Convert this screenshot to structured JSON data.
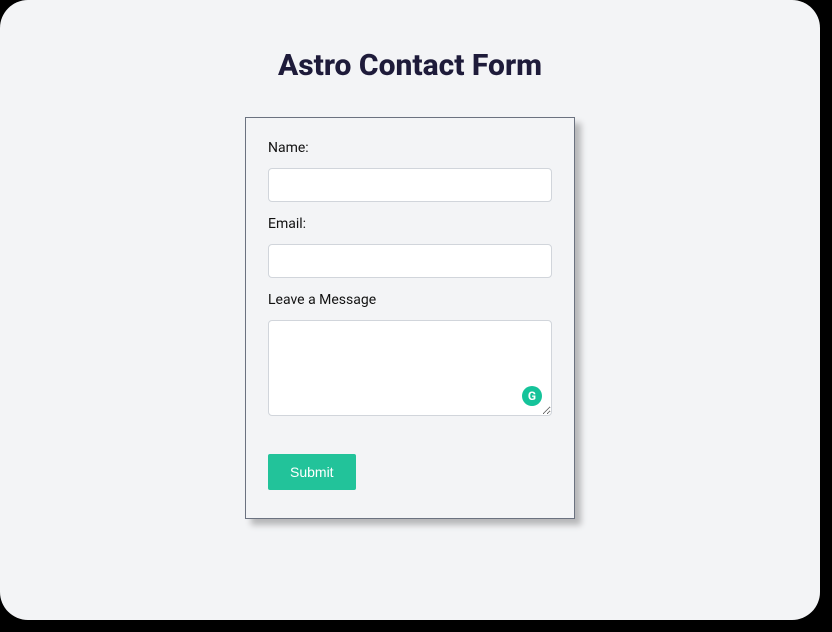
{
  "header": {
    "title": "Astro Contact Form"
  },
  "form": {
    "fields": {
      "name": {
        "label": "Name:",
        "value": ""
      },
      "email": {
        "label": "Email:",
        "value": ""
      },
      "message": {
        "label": "Leave a Message",
        "value": ""
      }
    },
    "submit_label": "Submit"
  },
  "badges": {
    "grammarly_glyph": "G"
  },
  "colors": {
    "accent": "#22c39a",
    "title": "#1e1b3a",
    "window_bg": "#f3f4f6"
  }
}
